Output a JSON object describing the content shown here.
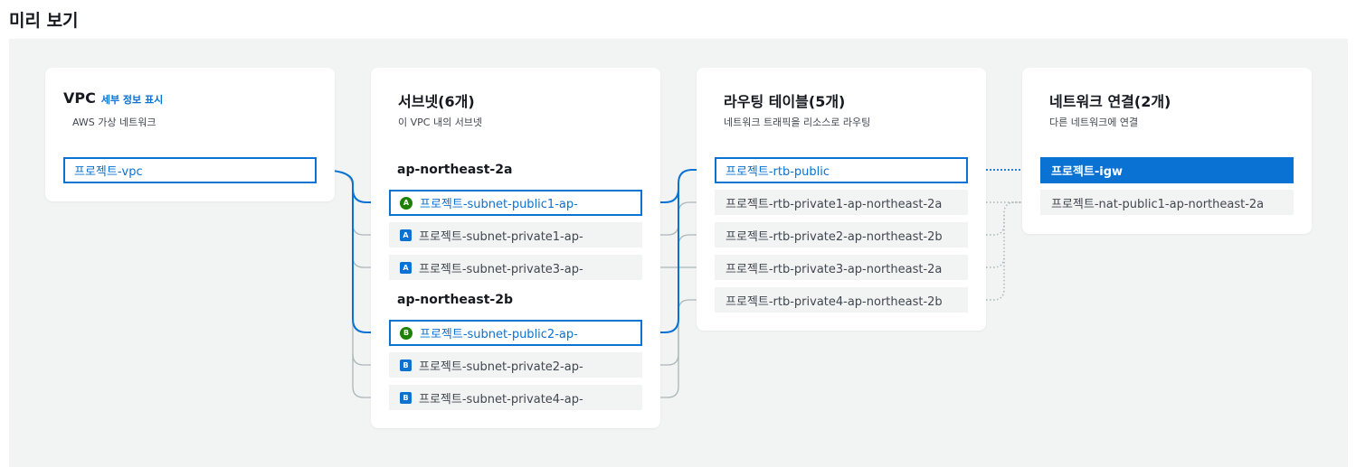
{
  "page": {
    "title": "미리 보기"
  },
  "vpc": {
    "title": "VPC",
    "details_link": "세부 정보 표시",
    "subtitle": "AWS 가상 네트워크",
    "node": "프로젝트-vpc"
  },
  "subnets": {
    "title": "서브넷(6개)",
    "subtitle": "이 VPC 내의 서브넷",
    "groups": [
      {
        "label": "ap-northeast-2a",
        "items": [
          {
            "badge": "A",
            "name": "프로젝트-subnet-public1-ap-",
            "selected": true
          },
          {
            "badge": "A",
            "name": "프로젝트-subnet-private1-ap-",
            "selected": false
          },
          {
            "badge": "A",
            "name": "프로젝트-subnet-private3-ap-",
            "selected": false
          }
        ]
      },
      {
        "label": "ap-northeast-2b",
        "items": [
          {
            "badge": "B",
            "name": "프로젝트-subnet-public2-ap-",
            "selected": true
          },
          {
            "badge": "B",
            "name": "프로젝트-subnet-private2-ap-",
            "selected": false
          },
          {
            "badge": "B",
            "name": "프로젝트-subnet-private4-ap-",
            "selected": false
          }
        ]
      }
    ]
  },
  "route_tables": {
    "title": "라우팅 테이블(5개)",
    "subtitle": "네트워크 트래픽을 리소스로 라우팅",
    "items": [
      {
        "name": "프로젝트-rtb-public",
        "selected": true
      },
      {
        "name": "프로젝트-rtb-private1-ap-northeast-2a",
        "selected": false
      },
      {
        "name": "프로젝트-rtb-private2-ap-northeast-2b",
        "selected": false
      },
      {
        "name": "프로젝트-rtb-private3-ap-northeast-2a",
        "selected": false
      },
      {
        "name": "프로젝트-rtb-private4-ap-northeast-2b",
        "selected": false
      }
    ]
  },
  "network_connections": {
    "title": "네트워크 연결(2개)",
    "subtitle": "다른 네트워크에 연결",
    "items": [
      {
        "name": "프로젝트-igw",
        "selected": true
      },
      {
        "name": "프로젝트-nat-public1-ap-northeast-2a",
        "selected": false
      }
    ]
  },
  "colors": {
    "accent": "#0972d3",
    "badge_public": "#1d8102",
    "line_inactive": "#aab7b8",
    "canvas": "#f2f3f3"
  }
}
